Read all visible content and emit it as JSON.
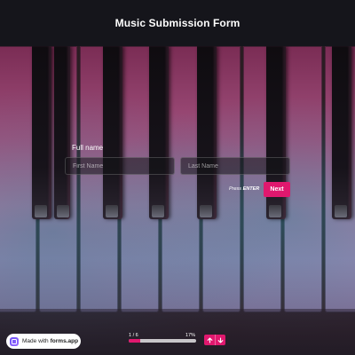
{
  "form": {
    "title": "Music Submission Form",
    "question_label": "Full name",
    "first_name_placeholder": "First Name",
    "last_name_placeholder": "Last Name",
    "press_prefix": "Press",
    "press_key": "ENTER",
    "next_label": "Next"
  },
  "footer": {
    "made_with_prefix": "Made with",
    "made_with_brand": "forms.app",
    "progress_count": "1 / 6",
    "progress_percent": "17%",
    "progress_fraction": 0.17
  },
  "colors": {
    "accent": "#e0186e",
    "header_bg": "#15151b"
  },
  "icons": {
    "up": "arrow-up-icon",
    "down": "arrow-down-icon",
    "logo": "forms-app-logo-icon"
  }
}
